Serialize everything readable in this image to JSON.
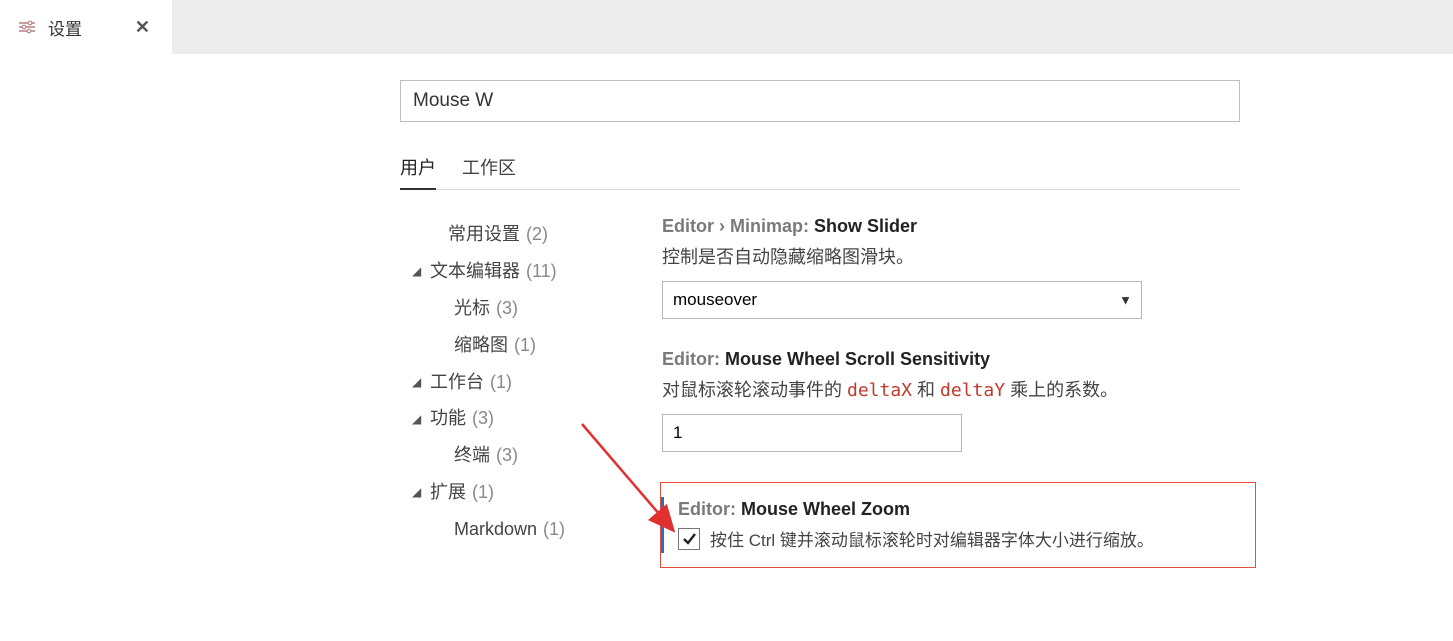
{
  "tab": {
    "title": "设置"
  },
  "search": {
    "value": "Mouse W"
  },
  "scope": {
    "user": "用户",
    "workspace": "工作区"
  },
  "toc": {
    "common": {
      "label": "常用设置",
      "count": "(2)"
    },
    "textEditor": {
      "label": "文本编辑器",
      "count": "(11)"
    },
    "cursor": {
      "label": "光标",
      "count": "(3)"
    },
    "minimap": {
      "label": "缩略图",
      "count": "(1)"
    },
    "workbench": {
      "label": "工作台",
      "count": "(1)"
    },
    "features": {
      "label": "功能",
      "count": "(3)"
    },
    "terminal": {
      "label": "终端",
      "count": "(3)"
    },
    "extensions": {
      "label": "扩展",
      "count": "(1)"
    },
    "markdown": {
      "label": "Markdown",
      "count": "(1)"
    }
  },
  "settings": {
    "showSlider": {
      "cat": "Editor › Minimap: ",
      "name": "Show Slider",
      "desc": "控制是否自动隐藏缩略图滑块。",
      "value": "mouseover"
    },
    "scrollSens": {
      "cat": "Editor: ",
      "name": "Mouse Wheel Scroll Sensitivity",
      "desc_a": "对鼠标滚轮滚动事件的 ",
      "code1": "deltaX",
      "mid": " 和 ",
      "code2": "deltaY",
      "desc_b": " 乘上的系数。",
      "value": "1"
    },
    "wheelZoom": {
      "cat": "Editor: ",
      "name": "Mouse Wheel Zoom",
      "desc_a": "按住 ",
      "code1": "Ctrl",
      "desc_b": " 键并滚动鼠标滚轮时对编辑器字体大小进行缩放。"
    }
  }
}
